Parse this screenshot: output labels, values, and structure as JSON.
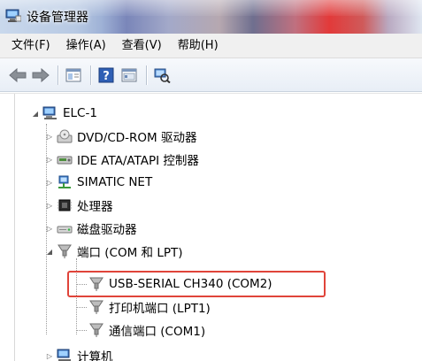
{
  "window": {
    "title": "设备管理器"
  },
  "menu": [
    {
      "label": "文件(F)"
    },
    {
      "label": "操作(A)"
    },
    {
      "label": "查看(V)"
    },
    {
      "label": "帮助(H)"
    }
  ],
  "toolbar": {
    "buttons": [
      "back-icon",
      "forward-icon",
      "show-hide-console-tree-icon",
      "help-icon",
      "properties-icon",
      "scan-hardware-icon"
    ]
  },
  "tree": {
    "root": "ELC-1",
    "nodes": [
      {
        "label": "DVD/CD-ROM 驱动器",
        "icon": "dvd-drive-icon",
        "expanded": false
      },
      {
        "label": "IDE ATA/ATAPI 控制器",
        "icon": "ide-controller-icon",
        "expanded": false
      },
      {
        "label": "SIMATIC NET",
        "icon": "simatic-net-icon",
        "expanded": false
      },
      {
        "label": "处理器",
        "icon": "processor-icon",
        "expanded": false
      },
      {
        "label": "磁盘驱动器",
        "icon": "disk-drive-icon",
        "expanded": false
      },
      {
        "label": "端口 (COM 和 LPT)",
        "icon": "port-icon",
        "expanded": true,
        "children": [
          {
            "label": "USB-SERIAL CH340 (COM2)",
            "highlighted": true
          },
          {
            "label": "打印机端口 (LPT1)"
          },
          {
            "label": "通信端口 (COM1)"
          }
        ]
      },
      {
        "label": "计算机",
        "icon": "computer-icon",
        "expanded": false
      }
    ]
  },
  "colors": {
    "highlight_border": "#e0443a"
  }
}
